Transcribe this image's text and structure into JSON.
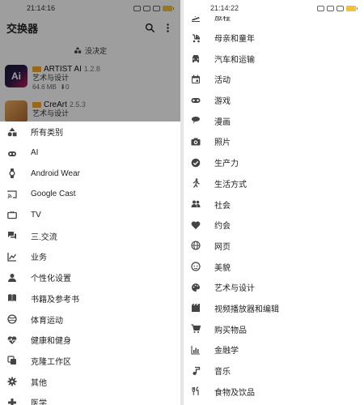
{
  "left": {
    "status": {
      "time": "21:14:16"
    },
    "appbar": {
      "title": "交换器",
      "search_icon": "search-icon",
      "more_icon": "more-vert-icon"
    },
    "subbar": {
      "label": "没决定"
    },
    "apps": [
      {
        "name": "ARTIST AI",
        "version": "1.2.8",
        "category": "艺术与设计",
        "size": "64.6 MB",
        "downloads": "0",
        "icon_text": "Ai",
        "icon_color": "#c2185b"
      },
      {
        "name": "CreArt",
        "version": "2.5.3",
        "category": "艺术与设计",
        "icon_text": "",
        "icon_color": "#d48a3c"
      }
    ],
    "menu": [
      {
        "label": "所有类别",
        "icon": "shapes-icon"
      },
      {
        "label": "AI",
        "icon": "robot-icon"
      },
      {
        "label": "Android Wear",
        "icon": "watch-icon"
      },
      {
        "label": "Google Cast",
        "icon": "cast-icon"
      },
      {
        "label": "TV",
        "icon": "tv-icon"
      },
      {
        "label": "三.交流",
        "icon": "chat-icon"
      },
      {
        "label": "业务",
        "icon": "chart-icon"
      },
      {
        "label": "个性化设置",
        "icon": "person-icon"
      },
      {
        "label": "书籍及参考书",
        "icon": "book-icon"
      },
      {
        "label": "体育运动",
        "icon": "sports-icon"
      },
      {
        "label": "健康和健身",
        "icon": "heart-pulse-icon"
      },
      {
        "label": "克隆工作区",
        "icon": "clone-icon"
      },
      {
        "label": "其他",
        "icon": "gear-icon"
      },
      {
        "label": "医学",
        "icon": "medical-icon"
      }
    ]
  },
  "right": {
    "status": {
      "time": "21:14:22"
    },
    "menu": [
      {
        "label": "旅程",
        "icon": "flight-icon"
      },
      {
        "label": "母亲和童年",
        "icon": "stroller-icon"
      },
      {
        "label": "汽车和运输",
        "icon": "car-icon"
      },
      {
        "label": "活动",
        "icon": "calendar-icon"
      },
      {
        "label": "游戏",
        "icon": "gamepad-icon"
      },
      {
        "label": "漫画",
        "icon": "comic-bubble-icon"
      },
      {
        "label": "照片",
        "icon": "camera-icon"
      },
      {
        "label": "生产力",
        "icon": "check-circle-icon"
      },
      {
        "label": "生活方式",
        "icon": "walk-icon"
      },
      {
        "label": "社会",
        "icon": "people-icon"
      },
      {
        "label": "约会",
        "icon": "heart-icon"
      },
      {
        "label": "网页",
        "icon": "globe-icon"
      },
      {
        "label": "美貌",
        "icon": "face-icon"
      },
      {
        "label": "艺术与设计",
        "icon": "palette-icon"
      },
      {
        "label": "视频播放器和编辑",
        "icon": "movie-icon"
      },
      {
        "label": "购买物品",
        "icon": "cart-icon"
      },
      {
        "label": "金融学",
        "icon": "finance-icon"
      },
      {
        "label": "音乐",
        "icon": "music-icon"
      },
      {
        "label": "食物及饮品",
        "icon": "food-icon"
      }
    ]
  }
}
